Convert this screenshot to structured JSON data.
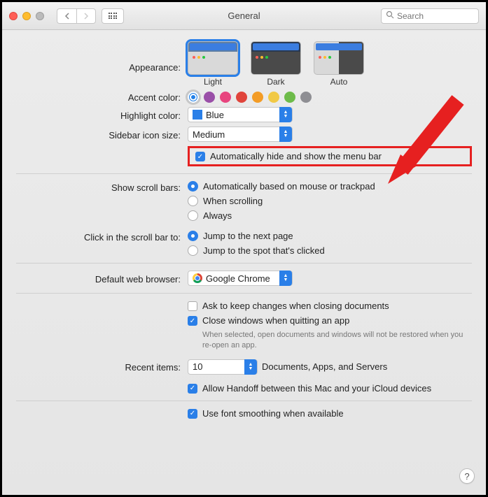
{
  "window": {
    "title": "General",
    "search_placeholder": "Search"
  },
  "appearance": {
    "label": "Appearance:",
    "options": [
      "Light",
      "Dark",
      "Auto"
    ],
    "selected": "Light"
  },
  "accent": {
    "label": "Accent color:",
    "colors": [
      "#1f7fe8",
      "#9a4fa8",
      "#e8457f",
      "#e0443b",
      "#f39c26",
      "#f1c945",
      "#6dbb4a",
      "#8e8e93"
    ],
    "selected_index": 0
  },
  "highlight": {
    "label": "Highlight color:",
    "value": "Blue"
  },
  "sidebar_size": {
    "label": "Sidebar icon size:",
    "value": "Medium"
  },
  "menubar_autohide": {
    "label": "Automatically hide and show the menu bar",
    "checked": true
  },
  "scrollbars": {
    "label": "Show scroll bars:",
    "options": [
      "Automatically based on mouse or trackpad",
      "When scrolling",
      "Always"
    ],
    "selected_index": 0
  },
  "scrollclick": {
    "label": "Click in the scroll bar to:",
    "options": [
      "Jump to the next page",
      "Jump to the spot that's clicked"
    ],
    "selected_index": 0
  },
  "browser": {
    "label": "Default web browser:",
    "value": "Google Chrome"
  },
  "ask_changes": {
    "label": "Ask to keep changes when closing documents",
    "checked": false
  },
  "close_windows": {
    "label": "Close windows when quitting an app",
    "checked": true,
    "note": "When selected, open documents and windows will not be restored when you re-open an app."
  },
  "recent": {
    "label": "Recent items:",
    "value": "10",
    "suffix": "Documents, Apps, and Servers"
  },
  "handoff": {
    "label": "Allow Handoff between this Mac and your iCloud devices",
    "checked": true
  },
  "fontsmoothing": {
    "label": "Use font smoothing when available",
    "checked": true
  },
  "help": "?"
}
